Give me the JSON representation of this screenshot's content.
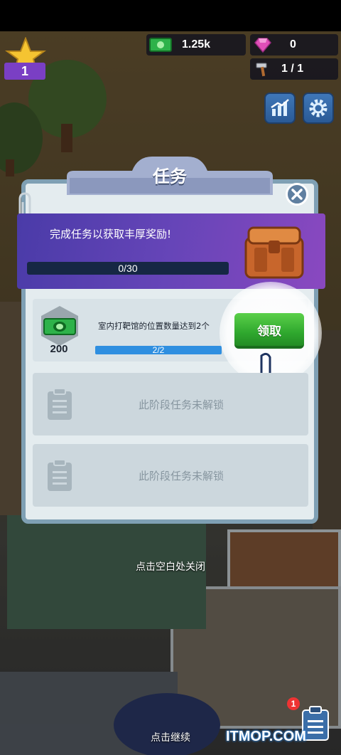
{
  "hud": {
    "level": "1",
    "cash": "1.25k",
    "gems": "0",
    "workers": "1 / 1"
  },
  "dialog": {
    "title": "任务",
    "banner_text": "完成任务以获取丰厚奖励!",
    "banner_progress": {
      "label": "0/30",
      "current": 0,
      "total": 30
    },
    "tasks": [
      {
        "reward_amount": "200",
        "description": "室内打靶馆的位置数量达到2个",
        "progress": {
          "label": "2/2",
          "current": 2,
          "total": 2
        },
        "button_label": "领取"
      },
      {
        "locked_text": "此阶段任务未解锁"
      },
      {
        "locked_text": "此阶段任务未解锁"
      }
    ],
    "close_hint": "点击空白处关闭"
  },
  "continue_hint": "点击继续",
  "task_badge_count": "1",
  "watermark": "ITMOP.COM",
  "colors": {
    "panel_bg": "#e4ecef",
    "banner_purple": "#6645b8",
    "claim_green": "#2fa82e",
    "progress_blue": "#2f8fe0"
  },
  "icons": [
    "star-icon",
    "cash-icon",
    "gem-icon",
    "hammer-icon",
    "chart-icon",
    "gear-icon",
    "close-icon",
    "paperclip-icon",
    "chest-icon",
    "clipboard-icon",
    "hand-pointer-icon"
  ]
}
